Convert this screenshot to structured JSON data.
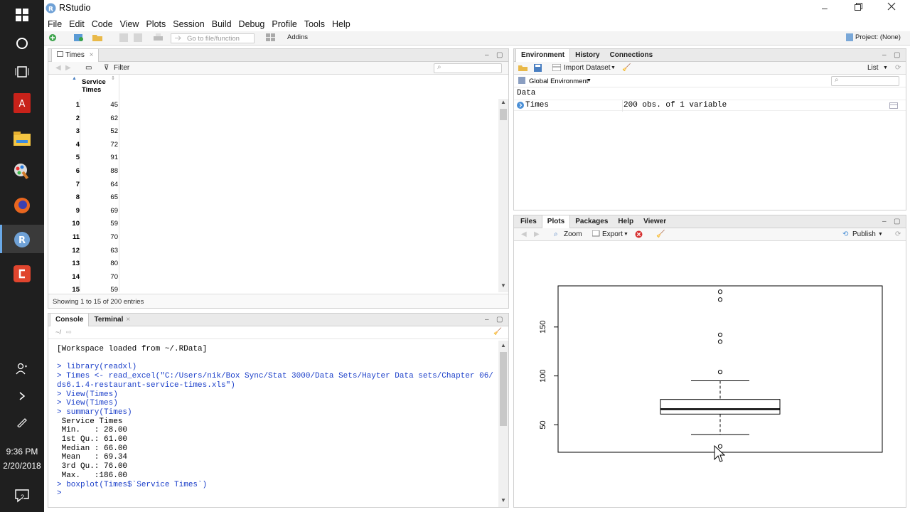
{
  "taskbar": {
    "time": "9:36 PM",
    "date": "2/20/2018",
    "notification_count": "2",
    "icons": [
      "windows-start-icon",
      "cortana-icon",
      "task-view-icon",
      "acrobat-icon",
      "file-explorer-icon",
      "paint-icon",
      "firefox-icon",
      "rstudio-icon",
      "app-red-icon",
      "people-icon",
      "chevron-right-icon",
      "pen-icon",
      "notification-icon"
    ]
  },
  "app": {
    "title": "RStudio",
    "menus": [
      "File",
      "Edit",
      "Code",
      "View",
      "Plots",
      "Session",
      "Build",
      "Debug",
      "Profile",
      "Tools",
      "Help"
    ],
    "toolbar": {
      "goto_placeholder": "Go to file/function",
      "addins_label": "Addins",
      "project_label": "Project: (None)"
    }
  },
  "source_pane": {
    "tab_label": "Times",
    "filter_label": "Filter",
    "column_header": "Service Times",
    "rows": [
      {
        "idx": "1",
        "val": "45"
      },
      {
        "idx": "2",
        "val": "62"
      },
      {
        "idx": "3",
        "val": "52"
      },
      {
        "idx": "4",
        "val": "72"
      },
      {
        "idx": "5",
        "val": "91"
      },
      {
        "idx": "6",
        "val": "88"
      },
      {
        "idx": "7",
        "val": "64"
      },
      {
        "idx": "8",
        "val": "65"
      },
      {
        "idx": "9",
        "val": "69"
      },
      {
        "idx": "10",
        "val": "59"
      },
      {
        "idx": "11",
        "val": "70"
      },
      {
        "idx": "12",
        "val": "63"
      },
      {
        "idx": "13",
        "val": "80"
      },
      {
        "idx": "14",
        "val": "70"
      },
      {
        "idx": "15",
        "val": "59"
      }
    ],
    "status": "Showing 1 to 15 of 200 entries"
  },
  "console_pane": {
    "tabs": [
      "Console",
      "Terminal"
    ],
    "path": "~/",
    "lines": [
      {
        "text": "[Workspace loaded from ~/.RData]",
        "cmd": false
      },
      {
        "text": "",
        "cmd": false
      },
      {
        "text": "> library(readxl)",
        "cmd": true
      },
      {
        "text": "> Times <- read_excel(\"C:/Users/nik/Box Sync/Stat 3000/Data Sets/Hayter Data sets/Chapter 06/",
        "cmd": true
      },
      {
        "text": "ds6.1.4-restaurant-service-times.xls\")",
        "cmd": true
      },
      {
        "text": "> View(Times)",
        "cmd": true
      },
      {
        "text": "> View(Times)",
        "cmd": true
      },
      {
        "text": "> summary(Times)",
        "cmd": true
      },
      {
        "text": " Service Times",
        "cmd": false
      },
      {
        "text": " Min.   : 28.00",
        "cmd": false
      },
      {
        "text": " 1st Qu.: 61.00",
        "cmd": false
      },
      {
        "text": " Median : 66.00",
        "cmd": false
      },
      {
        "text": " Mean   : 69.34",
        "cmd": false
      },
      {
        "text": " 3rd Qu.: 76.00",
        "cmd": false
      },
      {
        "text": " Max.   :186.00",
        "cmd": false
      },
      {
        "text": "> boxplot(Times$`Service Times`)",
        "cmd": true
      },
      {
        "text": ">",
        "cmd": true
      }
    ]
  },
  "env_pane": {
    "tabs": [
      "Environment",
      "History",
      "Connections"
    ],
    "import_label": "Import Dataset",
    "list_label": "List",
    "global_env_label": "Global Environment",
    "section": "Data",
    "objects": [
      {
        "name": "Times",
        "desc": "200 obs. of 1 variable"
      }
    ]
  },
  "plots_pane": {
    "tabs": [
      "Files",
      "Plots",
      "Packages",
      "Help",
      "Viewer"
    ],
    "zoom_label": "Zoom",
    "export_label": "Export",
    "publish_label": "Publish"
  },
  "chart_data": {
    "type": "boxplot",
    "title": "",
    "xlabel": "",
    "ylabel": "",
    "yticks": [
      50,
      100,
      150
    ],
    "ylim": [
      22,
      192
    ],
    "box": {
      "whisker_low": 40,
      "q1": 61,
      "median": 66,
      "q3": 76,
      "whisker_high": 95
    },
    "outliers": [
      28,
      104,
      135,
      142,
      178,
      186
    ]
  }
}
